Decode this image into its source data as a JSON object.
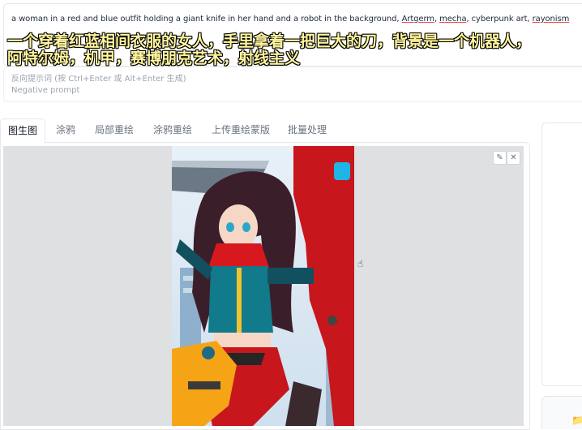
{
  "prompt": {
    "part1": "a woman in a red and blue outfit holding a giant knife in her hand and a robot in the background, ",
    "word_artgerm": "Artgerm",
    "sep1": ", ",
    "word_mecha": "mecha",
    "part2": ", cyberpunk art, ",
    "word_rayonism": "rayonism"
  },
  "overlay_caption": "一个穿着红蓝相间衣服的女人，手里拿着一把巨大的刀，背景是一个机器人，\n阿特尔姆，机甲，赛博朋克艺术，射线主义",
  "negative_prompt": {
    "placeholder_line1": "反向提示词 (按 Ctrl+Enter 或 Alt+Enter 生成)",
    "placeholder_line2": "Negative prompt"
  },
  "tabs": [
    {
      "label": "图生图",
      "active": true
    },
    {
      "label": "涂鸦",
      "active": false
    },
    {
      "label": "局部重绘",
      "active": false
    },
    {
      "label": "涂鸦重绘",
      "active": false
    },
    {
      "label": "上传重绘蒙版",
      "active": false
    },
    {
      "label": "批量处理",
      "active": false
    }
  ],
  "image_controls": {
    "edit_icon": "✎",
    "close_icon": "✕"
  },
  "icons": {
    "edit": "pencil-icon",
    "close": "close-icon",
    "folder": "folder-icon",
    "cursor": "hand-cursor-icon"
  }
}
